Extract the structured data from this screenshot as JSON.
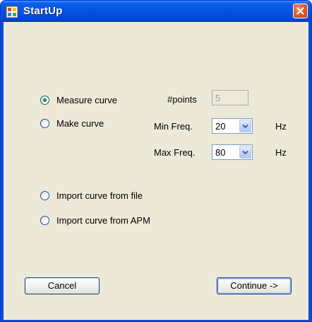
{
  "window": {
    "title": "StartUp",
    "icon": "app-window-icon",
    "close_icon": "close-icon"
  },
  "options": [
    {
      "label": "Measure curve",
      "checked": true
    },
    {
      "label": "Make curve",
      "checked": false
    },
    {
      "label": "Import curve from file",
      "checked": false
    },
    {
      "label": "Import curve from APM",
      "checked": false
    }
  ],
  "points": {
    "label": "#points",
    "value": "5"
  },
  "min_freq": {
    "label": "Min Freq.",
    "value": "20",
    "unit": "Hz"
  },
  "max_freq": {
    "label": "Max Freq.",
    "value": "80",
    "unit": "Hz"
  },
  "buttons": {
    "cancel": "Cancel",
    "continue": "Continue ->"
  },
  "colors": {
    "titlebar": "#0553e0",
    "dialog_bg": "#ece9d8",
    "close_button": "#e35a2c",
    "radio_checked": "#21a121"
  }
}
